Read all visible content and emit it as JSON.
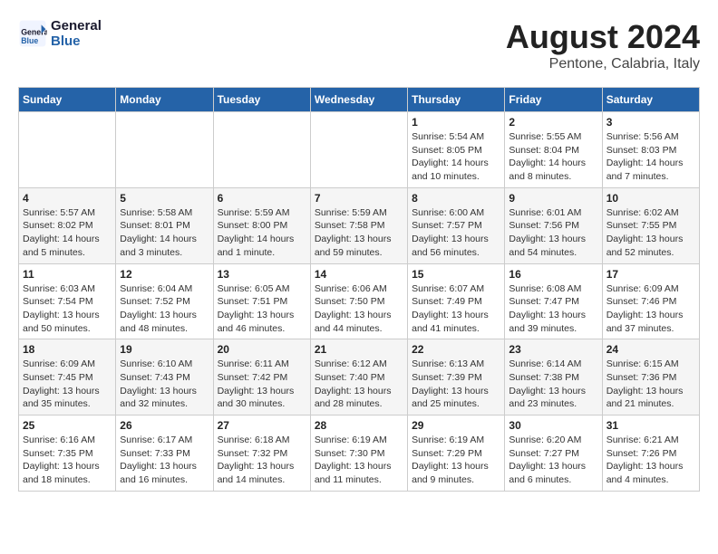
{
  "header": {
    "logo_line1": "General",
    "logo_line2": "Blue",
    "title": "August 2024",
    "subtitle": "Pentone, Calabria, Italy"
  },
  "calendar": {
    "days_of_week": [
      "Sunday",
      "Monday",
      "Tuesday",
      "Wednesday",
      "Thursday",
      "Friday",
      "Saturday"
    ],
    "weeks": [
      [
        {
          "day": "",
          "info": ""
        },
        {
          "day": "",
          "info": ""
        },
        {
          "day": "",
          "info": ""
        },
        {
          "day": "",
          "info": ""
        },
        {
          "day": "1",
          "info": "Sunrise: 5:54 AM\nSunset: 8:05 PM\nDaylight: 14 hours\nand 10 minutes."
        },
        {
          "day": "2",
          "info": "Sunrise: 5:55 AM\nSunset: 8:04 PM\nDaylight: 14 hours\nand 8 minutes."
        },
        {
          "day": "3",
          "info": "Sunrise: 5:56 AM\nSunset: 8:03 PM\nDaylight: 14 hours\nand 7 minutes."
        }
      ],
      [
        {
          "day": "4",
          "info": "Sunrise: 5:57 AM\nSunset: 8:02 PM\nDaylight: 14 hours\nand 5 minutes."
        },
        {
          "day": "5",
          "info": "Sunrise: 5:58 AM\nSunset: 8:01 PM\nDaylight: 14 hours\nand 3 minutes."
        },
        {
          "day": "6",
          "info": "Sunrise: 5:59 AM\nSunset: 8:00 PM\nDaylight: 14 hours\nand 1 minute."
        },
        {
          "day": "7",
          "info": "Sunrise: 5:59 AM\nSunset: 7:58 PM\nDaylight: 13 hours\nand 59 minutes."
        },
        {
          "day": "8",
          "info": "Sunrise: 6:00 AM\nSunset: 7:57 PM\nDaylight: 13 hours\nand 56 minutes."
        },
        {
          "day": "9",
          "info": "Sunrise: 6:01 AM\nSunset: 7:56 PM\nDaylight: 13 hours\nand 54 minutes."
        },
        {
          "day": "10",
          "info": "Sunrise: 6:02 AM\nSunset: 7:55 PM\nDaylight: 13 hours\nand 52 minutes."
        }
      ],
      [
        {
          "day": "11",
          "info": "Sunrise: 6:03 AM\nSunset: 7:54 PM\nDaylight: 13 hours\nand 50 minutes."
        },
        {
          "day": "12",
          "info": "Sunrise: 6:04 AM\nSunset: 7:52 PM\nDaylight: 13 hours\nand 48 minutes."
        },
        {
          "day": "13",
          "info": "Sunrise: 6:05 AM\nSunset: 7:51 PM\nDaylight: 13 hours\nand 46 minutes."
        },
        {
          "day": "14",
          "info": "Sunrise: 6:06 AM\nSunset: 7:50 PM\nDaylight: 13 hours\nand 44 minutes."
        },
        {
          "day": "15",
          "info": "Sunrise: 6:07 AM\nSunset: 7:49 PM\nDaylight: 13 hours\nand 41 minutes."
        },
        {
          "day": "16",
          "info": "Sunrise: 6:08 AM\nSunset: 7:47 PM\nDaylight: 13 hours\nand 39 minutes."
        },
        {
          "day": "17",
          "info": "Sunrise: 6:09 AM\nSunset: 7:46 PM\nDaylight: 13 hours\nand 37 minutes."
        }
      ],
      [
        {
          "day": "18",
          "info": "Sunrise: 6:09 AM\nSunset: 7:45 PM\nDaylight: 13 hours\nand 35 minutes."
        },
        {
          "day": "19",
          "info": "Sunrise: 6:10 AM\nSunset: 7:43 PM\nDaylight: 13 hours\nand 32 minutes."
        },
        {
          "day": "20",
          "info": "Sunrise: 6:11 AM\nSunset: 7:42 PM\nDaylight: 13 hours\nand 30 minutes."
        },
        {
          "day": "21",
          "info": "Sunrise: 6:12 AM\nSunset: 7:40 PM\nDaylight: 13 hours\nand 28 minutes."
        },
        {
          "day": "22",
          "info": "Sunrise: 6:13 AM\nSunset: 7:39 PM\nDaylight: 13 hours\nand 25 minutes."
        },
        {
          "day": "23",
          "info": "Sunrise: 6:14 AM\nSunset: 7:38 PM\nDaylight: 13 hours\nand 23 minutes."
        },
        {
          "day": "24",
          "info": "Sunrise: 6:15 AM\nSunset: 7:36 PM\nDaylight: 13 hours\nand 21 minutes."
        }
      ],
      [
        {
          "day": "25",
          "info": "Sunrise: 6:16 AM\nSunset: 7:35 PM\nDaylight: 13 hours\nand 18 minutes."
        },
        {
          "day": "26",
          "info": "Sunrise: 6:17 AM\nSunset: 7:33 PM\nDaylight: 13 hours\nand 16 minutes."
        },
        {
          "day": "27",
          "info": "Sunrise: 6:18 AM\nSunset: 7:32 PM\nDaylight: 13 hours\nand 14 minutes."
        },
        {
          "day": "28",
          "info": "Sunrise: 6:19 AM\nSunset: 7:30 PM\nDaylight: 13 hours\nand 11 minutes."
        },
        {
          "day": "29",
          "info": "Sunrise: 6:19 AM\nSunset: 7:29 PM\nDaylight: 13 hours\nand 9 minutes."
        },
        {
          "day": "30",
          "info": "Sunrise: 6:20 AM\nSunset: 7:27 PM\nDaylight: 13 hours\nand 6 minutes."
        },
        {
          "day": "31",
          "info": "Sunrise: 6:21 AM\nSunset: 7:26 PM\nDaylight: 13 hours\nand 4 minutes."
        }
      ]
    ]
  }
}
